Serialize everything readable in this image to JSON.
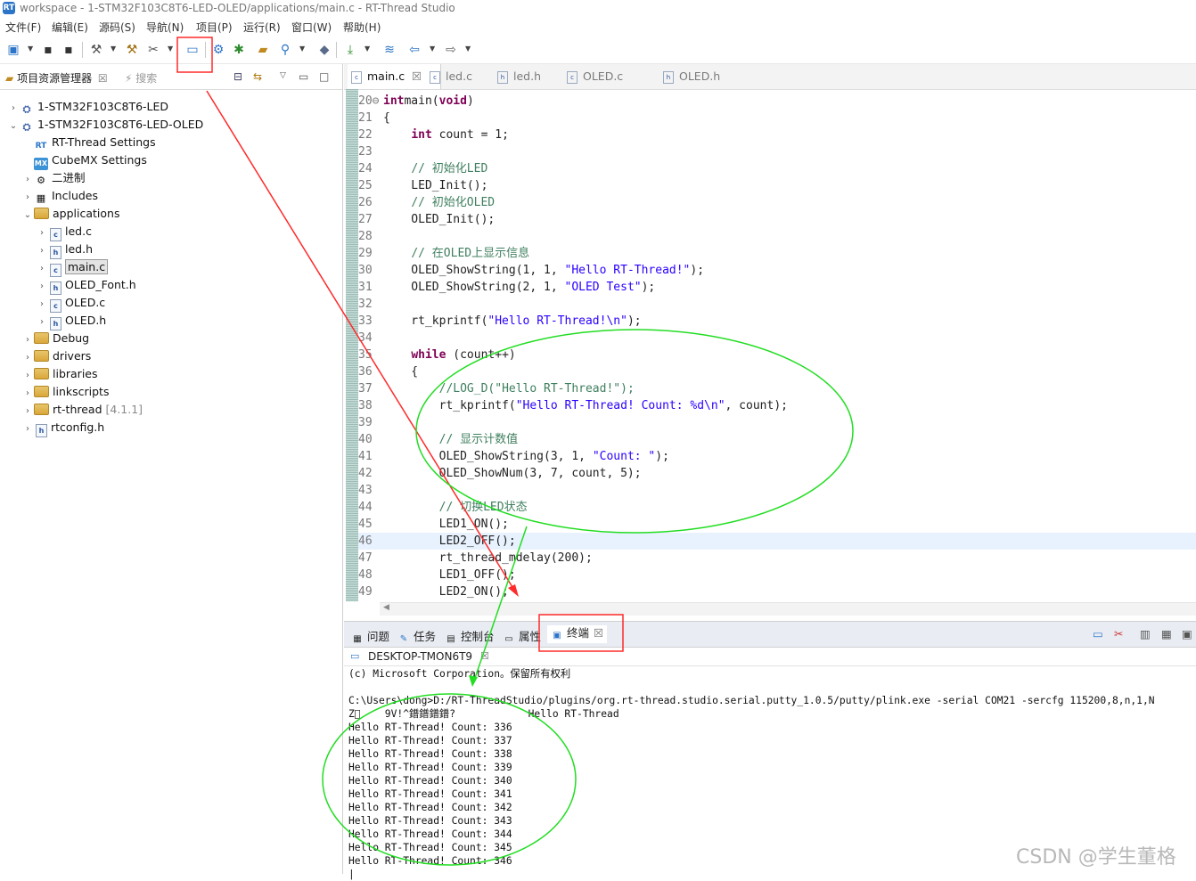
{
  "window": {
    "title": "workspace - 1-STM32F103C8T6-LED-OLED/applications/main.c - RT-Thread Studio"
  },
  "menu": [
    "文件(F)",
    "编辑(E)",
    "源码(S)",
    "导航(N)",
    "项目(P)",
    "运行(R)",
    "窗口(W)",
    "帮助(H)"
  ],
  "explorer": {
    "tab_label": "项目资源管理器",
    "search_label": "搜索",
    "tree": [
      {
        "label": "1-STM32F103C8T6-LED",
        "depth": 0,
        "chev": "›",
        "icon": "project-icon"
      },
      {
        "label": "1-STM32F103C8T6-LED-OLED",
        "depth": 0,
        "chev": "⌄",
        "icon": "project-icon"
      },
      {
        "label": "RT-Thread Settings",
        "depth": 1,
        "chev": "",
        "icon": "rt-settings-icon"
      },
      {
        "label": "CubeMX Settings",
        "depth": 1,
        "chev": "",
        "icon": "cubemx-icon"
      },
      {
        "label": "二进制",
        "depth": 1,
        "chev": "›",
        "icon": "binaries-icon"
      },
      {
        "label": "Includes",
        "depth": 1,
        "chev": "›",
        "icon": "includes-icon"
      },
      {
        "label": "applications",
        "depth": 1,
        "chev": "⌄",
        "icon": "folder-icon"
      },
      {
        "label": "led.c",
        "depth": 2,
        "chev": "›",
        "icon": "c-file-icon"
      },
      {
        "label": "led.h",
        "depth": 2,
        "chev": "›",
        "icon": "h-file-icon"
      },
      {
        "label": "main.c",
        "depth": 2,
        "chev": "›",
        "icon": "c-file-icon",
        "selected": true
      },
      {
        "label": "OLED_Font.h",
        "depth": 2,
        "chev": "›",
        "icon": "h-file-icon"
      },
      {
        "label": "OLED.c",
        "depth": 2,
        "chev": "›",
        "icon": "c-file-icon"
      },
      {
        "label": "OLED.h",
        "depth": 2,
        "chev": "›",
        "icon": "h-file-icon"
      },
      {
        "label": "Debug",
        "depth": 1,
        "chev": "›",
        "icon": "folder-icon"
      },
      {
        "label": "drivers",
        "depth": 1,
        "chev": "›",
        "icon": "folder-icon"
      },
      {
        "label": "libraries",
        "depth": 1,
        "chev": "›",
        "icon": "folder-icon"
      },
      {
        "label": "linkscripts",
        "depth": 1,
        "chev": "›",
        "icon": "folder-icon"
      },
      {
        "label": "rt-thread",
        "depth": 1,
        "chev": "›",
        "icon": "folder-icon",
        "suffix": "[4.1.1]"
      },
      {
        "label": "rtconfig.h",
        "depth": 1,
        "chev": "›",
        "icon": "h-file-icon"
      }
    ]
  },
  "editor": {
    "tabs": [
      {
        "label": "main.c",
        "type": "c",
        "active": true
      },
      {
        "label": "led.c",
        "type": "c"
      },
      {
        "label": "led.h",
        "type": "h"
      },
      {
        "label": "OLED.c",
        "type": "c"
      },
      {
        "label": "OLED.h",
        "type": "h"
      }
    ],
    "lines": [
      {
        "num": "20⊖",
        "tokens": [
          [
            "kw",
            "int"
          ],
          [
            "",
            "main("
          ],
          [
            "kw",
            "void"
          ],
          [
            "",
            ")"
          ]
        ]
      },
      {
        "num": "21",
        "tokens": [
          [
            "",
            "{"
          ]
        ]
      },
      {
        "num": "22",
        "tokens": [
          [
            "",
            "    "
          ],
          [
            "kw",
            "int"
          ],
          [
            "",
            " count = 1;"
          ]
        ]
      },
      {
        "num": "23",
        "tokens": [
          [
            "",
            ""
          ]
        ]
      },
      {
        "num": "24",
        "tokens": [
          [
            "",
            "    "
          ],
          [
            "cmt",
            "// 初始化LED"
          ]
        ]
      },
      {
        "num": "25",
        "tokens": [
          [
            "",
            "    LED_Init();"
          ]
        ]
      },
      {
        "num": "26",
        "tokens": [
          [
            "",
            "    "
          ],
          [
            "cmt",
            "// 初始化OLED"
          ]
        ]
      },
      {
        "num": "27",
        "tokens": [
          [
            "",
            "    OLED_Init();"
          ]
        ]
      },
      {
        "num": "28",
        "tokens": [
          [
            "",
            ""
          ]
        ]
      },
      {
        "num": "29",
        "tokens": [
          [
            "",
            "    "
          ],
          [
            "cmt",
            "// 在OLED上显示信息"
          ]
        ]
      },
      {
        "num": "30",
        "tokens": [
          [
            "",
            "    OLED_ShowString(1, 1, "
          ],
          [
            "str",
            "\"Hello RT-Thread!\""
          ],
          [
            "",
            ");"
          ]
        ]
      },
      {
        "num": "31",
        "tokens": [
          [
            "",
            "    OLED_ShowString(2, 1, "
          ],
          [
            "str",
            "\"OLED Test\""
          ],
          [
            "",
            ");"
          ]
        ]
      },
      {
        "num": "32",
        "tokens": [
          [
            "",
            ""
          ]
        ]
      },
      {
        "num": "33",
        "tokens": [
          [
            "",
            "    rt_kprintf("
          ],
          [
            "str",
            "\"Hello RT-Thread!\\n\""
          ],
          [
            "",
            ");"
          ]
        ]
      },
      {
        "num": "34",
        "tokens": [
          [
            "",
            ""
          ]
        ]
      },
      {
        "num": "35",
        "tokens": [
          [
            "",
            "    "
          ],
          [
            "kw",
            "while"
          ],
          [
            "",
            " (count++)"
          ]
        ]
      },
      {
        "num": "36",
        "tokens": [
          [
            "",
            "    {"
          ]
        ]
      },
      {
        "num": "37",
        "tokens": [
          [
            "",
            "        "
          ],
          [
            "cmt",
            "//LOG_D(\"Hello RT-Thread!\");"
          ]
        ]
      },
      {
        "num": "38",
        "tokens": [
          [
            "",
            "        rt_kprintf("
          ],
          [
            "str",
            "\"Hello RT-Thread! Count: %d\\n\""
          ],
          [
            "",
            ", count);"
          ]
        ]
      },
      {
        "num": "39",
        "tokens": [
          [
            "",
            ""
          ]
        ]
      },
      {
        "num": "40",
        "tokens": [
          [
            "",
            "        "
          ],
          [
            "cmt",
            "// 显示计数值"
          ]
        ]
      },
      {
        "num": "41",
        "tokens": [
          [
            "",
            "        OLED_ShowString(3, 1, "
          ],
          [
            "str",
            "\"Count: \""
          ],
          [
            "",
            ");"
          ]
        ]
      },
      {
        "num": "42",
        "tokens": [
          [
            "",
            "        OLED_ShowNum(3, 7, count, 5);"
          ]
        ]
      },
      {
        "num": "43",
        "tokens": [
          [
            "",
            ""
          ]
        ]
      },
      {
        "num": "44",
        "tokens": [
          [
            "",
            "        "
          ],
          [
            "cmt",
            "// 切换LED状态"
          ]
        ]
      },
      {
        "num": "45",
        "tokens": [
          [
            "",
            "        LED1_ON();"
          ]
        ]
      },
      {
        "num": "46",
        "tokens": [
          [
            "",
            "        LED2_OFF();"
          ]
        ],
        "current": true
      },
      {
        "num": "47",
        "tokens": [
          [
            "",
            "        rt_thread_mdelay(200);"
          ]
        ]
      },
      {
        "num": "48",
        "tokens": [
          [
            "",
            "        LED1_OFF();"
          ]
        ]
      },
      {
        "num": "49",
        "tokens": [
          [
            "",
            "        LED2_ON();"
          ]
        ]
      }
    ]
  },
  "bottom_panel": {
    "tabs": [
      "问题",
      "任务",
      "控制台",
      "属性",
      "终端"
    ],
    "terminal_tab": "DESKTOP-TMON6T9",
    "terminal_lines": [
      "(c) Microsoft Corporation。保留所有权利",
      "",
      "C:\\Users\\dong>D:/RT-ThreadStudio/plugins/org.rt-thread.studio.serial.putty_1.0.5/putty/plink.exe -serial COM21 -sercfg 115200,8,n,1,N",
      "Z\u0000    9V!^鐠鐠鐠鐠?            Hello RT-Thread",
      "Hello RT-Thread! Count: 336",
      "Hello RT-Thread! Count: 337",
      "Hello RT-Thread! Count: 338",
      "Hello RT-Thread! Count: 339",
      "Hello RT-Thread! Count: 340",
      "Hello RT-Thread! Count: 341",
      "Hello RT-Thread! Count: 342",
      "Hello RT-Thread! Count: 343",
      "Hello RT-Thread! Count: 344",
      "Hello RT-Thread! Count: 345",
      "Hello RT-Thread! Count: 346"
    ]
  },
  "annotation": {
    "red": "#ff2a2a",
    "green": "#22dd22"
  },
  "watermark": "CSDN @学生董格"
}
